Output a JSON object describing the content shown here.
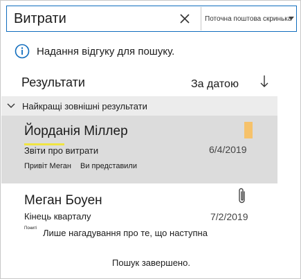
{
  "search": {
    "query": "Витрати",
    "scope": "Поточна поштова скринька"
  },
  "feedback": {
    "text": "Надання відгуку для пошуку."
  },
  "results_header": {
    "title": "Результати",
    "sort_label": "За датою"
  },
  "group": {
    "label": "Найкращі зовнішні результати"
  },
  "results": [
    {
      "sender": "Йорданія Міллер",
      "subject": "Звіти про витрати",
      "date": "6/4/2019",
      "preview_a": "Привіт Меган",
      "preview_b": "Ви представили",
      "has_flag": true,
      "flag_color": "#f6c26b",
      "selected": true
    },
    {
      "sender": "Меган Боуен",
      "subject": "Кінець кварталу",
      "date": "7/2/2019",
      "preview_small": "Пониті",
      "preview_rest": "Лише нагадування про те, що наступна",
      "has_attachment": true,
      "selected": false
    }
  ],
  "status": {
    "text": "Пошук завершено."
  },
  "colors": {
    "accent": "#0f6cbd",
    "selected_bg": "#dcdcdc",
    "group_bg": "#ececec",
    "highlight": "#f0e442"
  }
}
